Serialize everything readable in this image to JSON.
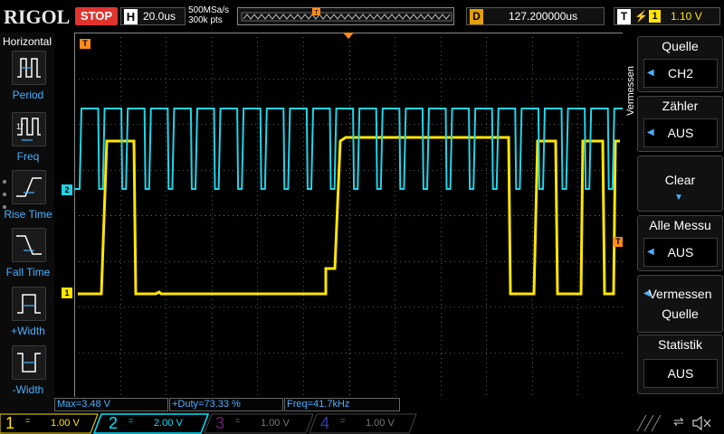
{
  "header": {
    "logo": "RIGOL",
    "run_state": "STOP",
    "timebase_label": "H",
    "timebase_value": "20.0us",
    "sample_rate": "500MSa/s",
    "memory_depth": "300k pts",
    "trigger_marker_label": "T",
    "delay_label": "D",
    "delay_value": "127.200000us",
    "trigger_label": "T",
    "trigger_edge": "⚡",
    "trigger_source": "1",
    "trigger_level": "1.10 V"
  },
  "left_panel": {
    "title": "Horizontal",
    "items": [
      {
        "label": "Period",
        "icon": "period-icon"
      },
      {
        "label": "Freq",
        "icon": "frequency-icon"
      },
      {
        "label": "Rise Time",
        "icon": "rise-time-icon"
      },
      {
        "label": "Fall Time",
        "icon": "fall-time-icon"
      },
      {
        "label": "+Width",
        "icon": "positive-width-icon"
      },
      {
        "label": "-Width",
        "icon": "negative-width-icon"
      }
    ]
  },
  "right_panel": {
    "vertical_tab": "Vermessen",
    "buttons": [
      {
        "title": "Quelle",
        "value": "CH2"
      },
      {
        "title": "Zähler",
        "value": "AUS"
      },
      {
        "title": "Clear",
        "value": ""
      },
      {
        "title": "Alle Messu",
        "value": "AUS"
      },
      {
        "title": "Vermessen",
        "value": "Quelle"
      },
      {
        "title": "Statistik",
        "value": "AUS"
      }
    ]
  },
  "measurements": [
    {
      "text": "Max=3.48 V"
    },
    {
      "text": "+Duty=73.33 %"
    },
    {
      "text": "Freq=41.7kHz"
    }
  ],
  "channel_markers": {
    "ch1": "1",
    "ch2": "2",
    "trigger_left": "T",
    "trigger_right": "T"
  },
  "channels": [
    {
      "number": "1",
      "coupling": "=",
      "scale": "1.00 V",
      "color": "#ffe600",
      "active": true
    },
    {
      "number": "2",
      "coupling": "=",
      "scale": "2.00 V",
      "color": "#00e5ff",
      "active": true
    },
    {
      "number": "3",
      "coupling": "=",
      "scale": "1.00 V",
      "color": "#b000d0",
      "active": false
    },
    {
      "number": "4",
      "coupling": "=",
      "scale": "1.00 V",
      "color": "#2050ff",
      "active": false
    }
  ],
  "colors": {
    "ch1": "#ffe600",
    "ch2": "#22d4e8",
    "trigger": "#ff8c1a",
    "accent": "#4ab0ff",
    "stop": "#e0342f"
  }
}
